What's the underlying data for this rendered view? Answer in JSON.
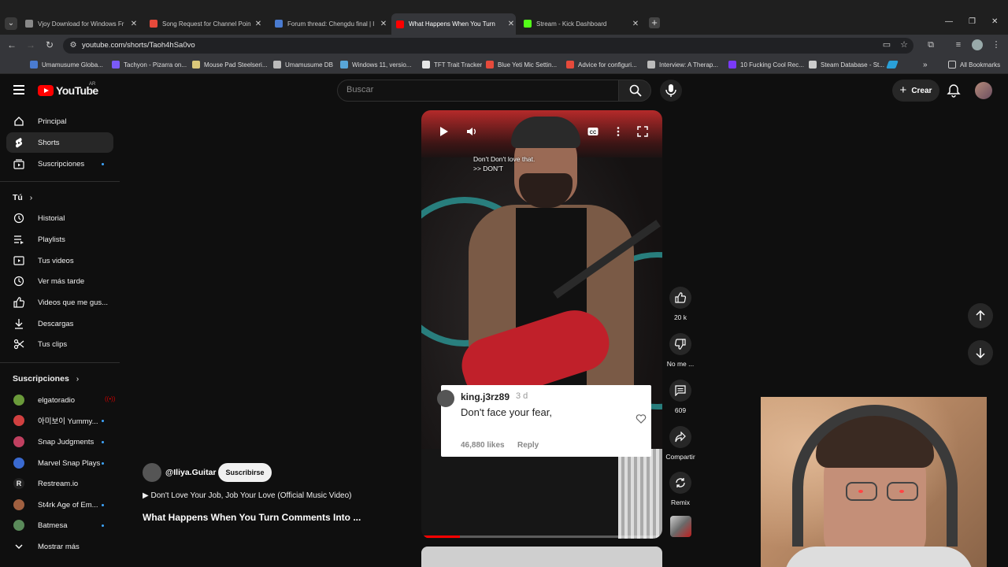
{
  "browser": {
    "tabs": [
      {
        "title": "Vjoy Download for Windows Fr",
        "color": "#888888"
      },
      {
        "title": "Song Request for Channel Poin",
        "color": "#e64a3b"
      },
      {
        "title": "Forum thread: Chengdu final | l",
        "color": "#4a7bd0"
      },
      {
        "title": "What Happens When You Turn",
        "color": "#ff0000"
      },
      {
        "title": "Stream - Kick Dashboard",
        "color": "#53fc18"
      }
    ],
    "new_tab": "+",
    "url": "youtube.com/shorts/Taoh4hSa0vo",
    "bookmarks": [
      {
        "label": "Umamusume Globa...",
        "color": "#4a7bd0"
      },
      {
        "label": "Tachyon - Pizarra on...",
        "color": "#7a5af8"
      },
      {
        "label": "Mouse Pad Steelseri...",
        "color": "#d9c77a"
      },
      {
        "label": "Umamusume DB",
        "color": "#bbbbbb"
      },
      {
        "label": "Windows 11, versio...",
        "color": "#58a6d8"
      },
      {
        "label": "TFT Trait Tracker",
        "color": "#e6e6e6"
      },
      {
        "label": "Blue Yeti Mic Settin...",
        "color": "#e64a3b"
      },
      {
        "label": "Advice for configuri...",
        "color": "#e64a3b"
      },
      {
        "label": "Interview: A Therap...",
        "color": "#bbbbbb"
      },
      {
        "label": "10 Fucking Cool Rec...",
        "color": "#7a3af8"
      },
      {
        "label": "Steam Database - St...",
        "color": "#cccccc"
      }
    ],
    "all_bookmarks": "All Bookmarks"
  },
  "youtube": {
    "logo_text": "YouTube",
    "country": "AR",
    "search_placeholder": "Buscar",
    "create_label": "Crear"
  },
  "sidebar": {
    "main": [
      {
        "label": "Principal",
        "icon": "home-icon"
      },
      {
        "label": "Shorts",
        "icon": "shorts-icon",
        "active": true
      },
      {
        "label": "Suscripciones",
        "icon": "subscriptions-icon"
      }
    ],
    "you_title": "Tú",
    "you": [
      {
        "label": "Historial",
        "icon": "history-icon"
      },
      {
        "label": "Playlists",
        "icon": "playlists-icon"
      },
      {
        "label": "Tus videos",
        "icon": "your-videos-icon"
      },
      {
        "label": "Ver más tarde",
        "icon": "watch-later-icon"
      },
      {
        "label": "Videos que me gus...",
        "icon": "liked-icon"
      },
      {
        "label": "Descargas",
        "icon": "downloads-icon"
      },
      {
        "label": "Tus clips",
        "icon": "clips-icon"
      }
    ],
    "subs_title": "Suscripciones",
    "subs": [
      {
        "label": "elgatoradio",
        "color": "#6a9a3a",
        "live": true
      },
      {
        "label": "아미보이 Yummy...",
        "color": "#d04040",
        "dot": true
      },
      {
        "label": "Snap Judgments",
        "color": "#c04060",
        "dot": true
      },
      {
        "label": "Marvel Snap Plays",
        "color": "#3a6ad0",
        "dot": true
      },
      {
        "label": "Restream.io",
        "color": "#222222",
        "dot": false,
        "letter": "R"
      },
      {
        "label": "St4rk Age of Em...",
        "color": "#a06040",
        "dot": true
      },
      {
        "label": "Batmesa",
        "color": "#5a8a5a",
        "dot": true
      }
    ],
    "show_more": "Mostrar más"
  },
  "short": {
    "caption_line1": "Don't Don't love that.",
    "caption_line2": ">> DON'T",
    "progress": 0.16,
    "comment": {
      "user": "king.j3rz89",
      "time": "3 d",
      "text": "Don't face your fear,",
      "likes": "46,880 likes",
      "reply": "Reply"
    },
    "channel": "@Iliya.Guitar",
    "subscribe": "Suscribirse",
    "music": "Don't Love Your Job, Job Your Love (Official Music Video)",
    "title": "What Happens When You Turn Comments Into ...",
    "actions": {
      "like_count": "20 k",
      "dislike_label": "No me ...",
      "comment_count": "609",
      "share_label": "Compartir",
      "remix_label": "Remix"
    }
  }
}
